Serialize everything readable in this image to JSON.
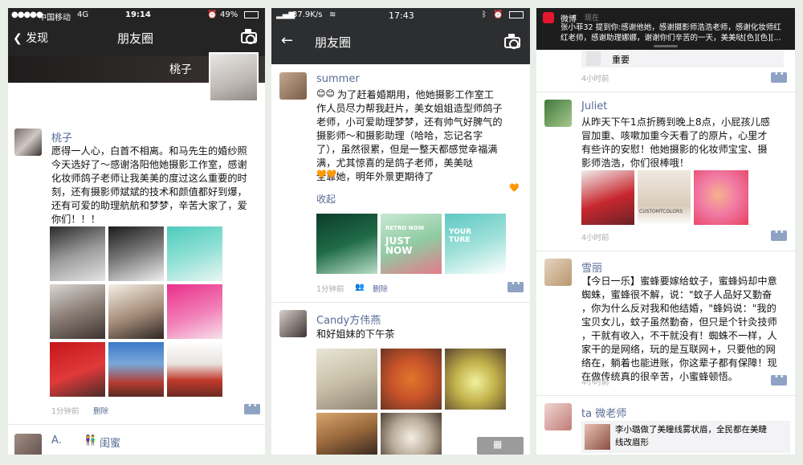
{
  "p1": {
    "status": {
      "carrier": "中国移动",
      "net": "4G",
      "time": "19:14",
      "battery": "49%"
    },
    "nav": {
      "back": "发现",
      "title": "朋友圈"
    },
    "self_name": "桃子",
    "post": {
      "name": "桃子",
      "text": "愿得一人心，白首不相离。和马先生的婚纱照\n今天选好了～感谢洛阳他她摄影工作室，感谢\n化妆师鸽子老师让我美美的度过这么重要的时\n刻，还有摄影师斌斌的技术和颜值都好到爆，\n还有可爱的助理航航和梦梦，辛苦大家了，爱\n你们！！！",
      "time": "1分钟前",
      "delete": "删除"
    },
    "next": {
      "name": "A.",
      "name2": "闺蜜"
    }
  },
  "p2": {
    "status": {
      "speed": "37.9K/s",
      "time": "17:43"
    },
    "nav": {
      "title": "朋友圈"
    },
    "post1": {
      "name": "summer",
      "text": "为了赶着婚期用，他她摄影工作室工\n作人员尽力帮我赶片，美女姐姐造型师鸽子\n老师，小可爱助理梦梦，还有帅气好脾气的\n摄影师～和摄影助理（哈哈，忘记名字\n了），虽然很累，但是一整天都感觉幸福满\n满，尤其惊喜的是鸽子老师，美美哒\n全靠她，明年外景更期待了",
      "collapse": "收起",
      "time": "1分钟前",
      "delete": "删除",
      "photo_texts": [
        "RETRO NOW",
        "JUST NOW",
        "YOUR TURE"
      ]
    },
    "post2": {
      "name": "Candy方伟燕",
      "text": "和好姐妹的下午茶"
    }
  },
  "p3": {
    "notif": {
      "app": "微博",
      "when": "现在",
      "text": "张小菲32 提到你:感谢他她，感谢摄影师浩浩老师，感谢化妆师红\n红老师，感谢助理娜娜，谢谢你们辛苦的一天，美美哒[色][色][..."
    },
    "top_card": {
      "text": "重要",
      "time": "4小时前"
    },
    "post1": {
      "name": "Juliet",
      "text": "从昨天下午1点折腾到晚上8点，小屁孩儿感\n冒加重、咳嗽加重今天看了的原片，心里才\n有些许的安慰！他她摄影的化妆师宝宝、摄\n影师浩浩，你们很棒哦！",
      "photo_label": "CUSTOMTCOLORS",
      "time": "4小时前"
    },
    "post2": {
      "name": "雪丽",
      "text": "【今日一乐】蜜蜂要嫁给蚊子，蜜蜂妈却中意\n蜘蛛，蜜蜂很不解，说：\"蚊子人品好又勤奋\n，你为什么反对我和他结婚，\"蜂妈说：\"我的\n宝贝女儿，蚊子虽然勤奋，但只是个针灸技师\n，干就有收入，不干就没有！蜘蛛不一样，人\n家干的是网络，玩的是互联网+，只要他的网\n络在，躺着也能进账，你这辈子都有保障！现\n在做传统真的很辛苦，小蜜蜂顿悟。",
      "time": "4小时前"
    },
    "post3": {
      "name": "ta 微老师",
      "share": "李小璐做了美瞳线雾状眉，全民都在美睫\n线改眉形"
    }
  }
}
